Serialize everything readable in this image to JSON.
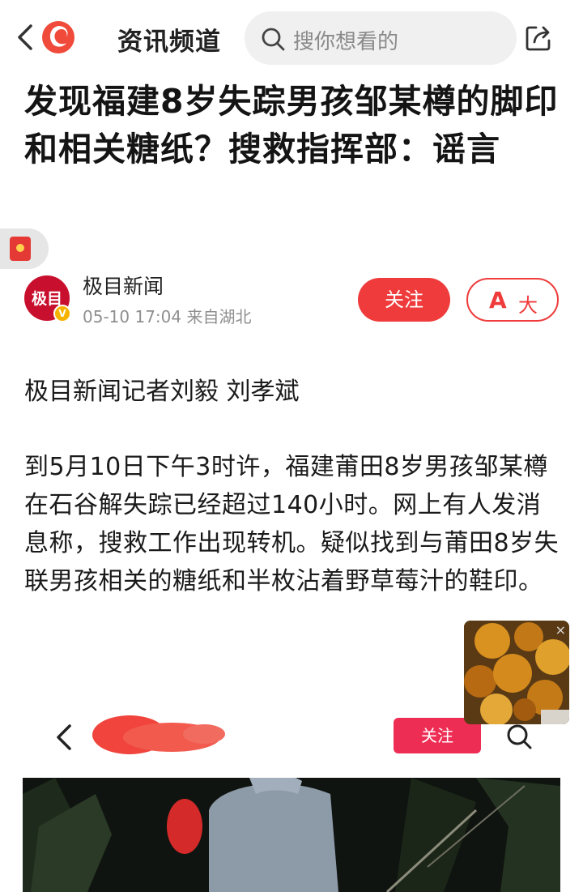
{
  "header": {
    "back_icon": "chevron-left-icon",
    "logo_icon": "phoenix-logo-icon",
    "channel_title": "资讯频道",
    "search_placeholder": "搜你想看的",
    "share_icon": "share-icon"
  },
  "article": {
    "title": "发现福建8岁失踪男孩邹某樽的脚印和相关糖纸？搜救指挥部：谣言",
    "author": {
      "name": "极目新闻",
      "avatar_text": "极目",
      "verified_badge": "V",
      "meta": "05-10 17:04 来自湖北"
    },
    "follow_label": "关注",
    "font_size_label": "大",
    "font_size_glyph": "A",
    "byline": "极目新闻记者刘毅 刘孝斌",
    "paragraph": "到5月10日下午3时许，福建莆田8岁男孩邹某樽在石谷解失踪已经超过140小时。网上有人发消息称，搜救工作出现转机。疑似找到与莆田8岁失联男孩相关的糖纸和半枚沾着野草莓汁的鞋印。"
  },
  "video_card": {
    "follow_label": "关注",
    "back_icon": "chevron-left-icon",
    "search_icon": "search-icon"
  },
  "colors": {
    "accent": "#ef3b3b",
    "card_follow": "#ee2d55",
    "search_bg": "#f0f0f0",
    "meta_gray": "#8f8f8f"
  }
}
